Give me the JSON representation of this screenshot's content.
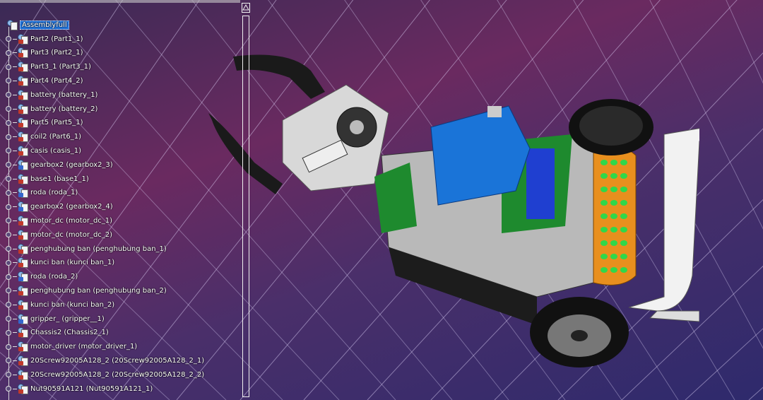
{
  "window": {
    "background_top": "#6a2a60",
    "background_bottom": "#2e2a6c",
    "accent": "#1e6fd6"
  },
  "tree": {
    "root": {
      "label": "Assemblyfull",
      "icon": "assembly-icon"
    },
    "items": [
      {
        "label": "Part2 (Part1_1)",
        "icon": "part-icon",
        "kind": "part"
      },
      {
        "label": "Part3 (Part2_1)",
        "icon": "part-icon",
        "kind": "part"
      },
      {
        "label": "Part3_1 (Part3_1)",
        "icon": "part-icon",
        "kind": "part"
      },
      {
        "label": "Part4 (Part4_2)",
        "icon": "part-icon",
        "kind": "part"
      },
      {
        "label": "battery (battery_1)",
        "icon": "part-icon",
        "kind": "part"
      },
      {
        "label": "battery (battery_2)",
        "icon": "part-icon",
        "kind": "part"
      },
      {
        "label": "Part5 (Part5_1)",
        "icon": "part-icon",
        "kind": "part"
      },
      {
        "label": "coil2 (Part6_1)",
        "icon": "part-icon",
        "kind": "part"
      },
      {
        "label": "casis (casis_1)",
        "icon": "part-icon",
        "kind": "part"
      },
      {
        "label": "gearbox2 (gearbox2_3)",
        "icon": "product-icon",
        "kind": "product"
      },
      {
        "label": "base1 (base1_1)",
        "icon": "part-icon",
        "kind": "part"
      },
      {
        "label": "roda (roda_1)",
        "icon": "product-icon",
        "kind": "product"
      },
      {
        "label": "gearbox2 (gearbox2_4)",
        "icon": "product-icon",
        "kind": "product"
      },
      {
        "label": "motor_dc (motor_dc_1)",
        "icon": "part-icon",
        "kind": "part"
      },
      {
        "label": "motor_dc (motor_dc_2)",
        "icon": "part-icon",
        "kind": "part"
      },
      {
        "label": "penghubung ban (penghubung ban_1)",
        "icon": "part-icon",
        "kind": "part"
      },
      {
        "label": "kunci ban (kunci ban_1)",
        "icon": "part-icon",
        "kind": "part"
      },
      {
        "label": "roda (roda_2)",
        "icon": "product-icon",
        "kind": "product"
      },
      {
        "label": "penghubung ban (penghubung ban_2)",
        "icon": "part-icon",
        "kind": "part"
      },
      {
        "label": "kunci ban (kunci ban_2)",
        "icon": "part-icon",
        "kind": "part"
      },
      {
        "label": "gripper_ (gripper__1)",
        "icon": "product-icon",
        "kind": "product"
      },
      {
        "label": "Chassis2 (Chassis2_1)",
        "icon": "part-icon",
        "kind": "part"
      },
      {
        "label": "motor_driver (motor_driver_1)",
        "icon": "part-icon",
        "kind": "part"
      },
      {
        "label": "20Screw92005A128_2 (20Screw92005A128_2_1)",
        "icon": "part-icon",
        "kind": "part"
      },
      {
        "label": "20Screw92005A128_2 (20Screw92005A128_2_2)",
        "icon": "part-icon",
        "kind": "part"
      },
      {
        "label": "Nut90591A121 (Nut90591A121_1)",
        "icon": "part-icon",
        "kind": "part"
      }
    ]
  },
  "model": {
    "name": "robot-assembly-render",
    "icon": "3d-model"
  }
}
